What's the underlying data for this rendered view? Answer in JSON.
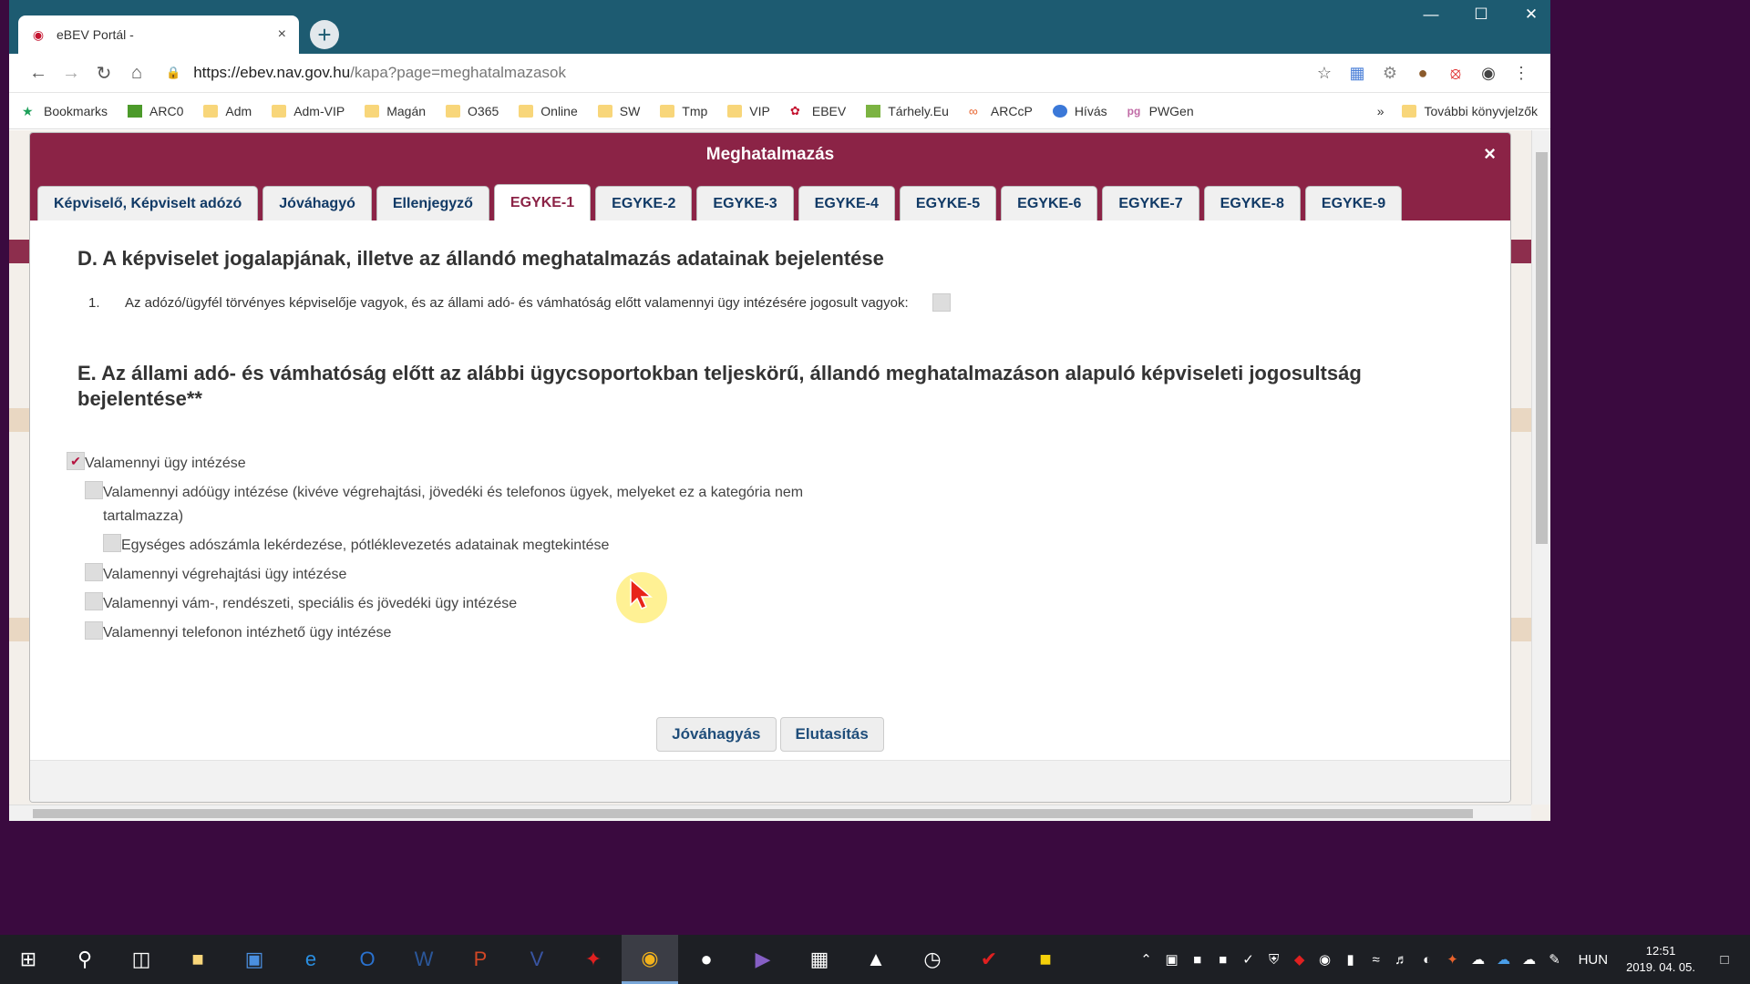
{
  "browser": {
    "tab_title": "eBEV Portál -",
    "tab_close": "×",
    "new_tab": "+",
    "window_controls": {
      "minimize": "—",
      "maximize": "☐",
      "close": "✕"
    },
    "url_host": "https://ebev.nav.gov.hu",
    "url_path": "/kapa?page=meghatalmazasok",
    "bookmarks": [
      {
        "label": "Bookmarks",
        "icon": "star-icon"
      },
      {
        "label": "ARC0",
        "icon": "green-square-icon"
      },
      {
        "label": "Adm",
        "icon": "folder-icon"
      },
      {
        "label": "Adm-VIP",
        "icon": "folder-icon"
      },
      {
        "label": "Magán",
        "icon": "folder-icon"
      },
      {
        "label": "O365",
        "icon": "folder-icon"
      },
      {
        "label": "Online",
        "icon": "folder-icon"
      },
      {
        "label": "SW",
        "icon": "folder-icon"
      },
      {
        "label": "Tmp",
        "icon": "folder-icon"
      },
      {
        "label": "VIP",
        "icon": "folder-icon"
      },
      {
        "label": "EBEV",
        "icon": "ebev-icon"
      },
      {
        "label": "Tárhely.Eu",
        "icon": "grid-icon"
      },
      {
        "label": "ARCcP",
        "icon": "link-icon"
      },
      {
        "label": "Hívás",
        "icon": "phone-icon"
      },
      {
        "label": "PWGen",
        "icon": "pg-icon"
      }
    ],
    "more_bookmarks_chevron": "»",
    "other_bookmarks": "További könyvjelzők"
  },
  "modal": {
    "title": "Meghatalmazás",
    "close": "×",
    "tabs": [
      "Képviselő, Képviselt adózó",
      "Jóváhagyó",
      "Ellenjegyző",
      "EGYKE-1",
      "EGYKE-2",
      "EGYKE-3",
      "EGYKE-4",
      "EGYKE-5",
      "EGYKE-6",
      "EGYKE-7",
      "EGYKE-8",
      "EGYKE-9"
    ],
    "active_tab": "EGYKE-1",
    "section_d_title": "D. A képviselet jogalapjának, illetve az állandó meghatalmazás adatainak bejelentése",
    "d_item_number": "1.",
    "d_item_text": "Az adózó/ügyfél törvényes képviselője vagyok, és az állami adó- és vámhatóság előtt valamennyi ügy intézésére jogosult vagyok:",
    "section_e_title": "E. Az állami adó- és vámhatóság előtt az alábbi ügycsoportokban teljeskörű, állandó meghatalmazáson alapuló képviseleti jogosultság bejelentése**",
    "options": [
      {
        "label": "Valamennyi ügy intézése",
        "checked": true
      },
      {
        "label": "Valamennyi adóügy intézése (kivéve végrehajtási, jövedéki és telefonos ügyek, melyeket ez a kategória nem tartalmazza)",
        "checked": false
      },
      {
        "label": "Egységes adószámla lekérdezése, pótléklevezetés adatainak megtekintése",
        "checked": false
      },
      {
        "label": "Valamennyi végrehajtási ügy intézése",
        "checked": false
      },
      {
        "label": "Valamennyi vám-, rendészeti, speciális és jövedéki ügy intézése",
        "checked": false
      },
      {
        "label": "Valamennyi telefonon intézhető ügy intézése",
        "checked": false
      }
    ],
    "approve_button": "Jóváhagyás",
    "reject_button": "Elutasítás"
  },
  "taskbar": {
    "language": "HUN",
    "time": "12:51",
    "date": "2019. 04. 05."
  },
  "colors": {
    "titlebar": "#1d5b71",
    "modal_header": "#8b2346",
    "desktop": "#3a0a3f",
    "taskbar": "#1d1f24"
  }
}
